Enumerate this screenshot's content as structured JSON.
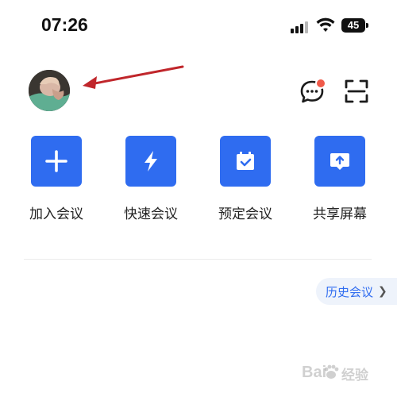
{
  "status_bar": {
    "time": "07:26",
    "battery": "45",
    "icons": [
      "signal-icon",
      "wifi-icon",
      "battery-icon"
    ]
  },
  "header": {
    "avatar": "user-avatar",
    "icons": [
      "message-icon",
      "scan-icon"
    ],
    "notification_dot_color": "#f05a4a",
    "annotation_arrow_color": "#c0262b"
  },
  "actions": [
    {
      "label": "加入会议",
      "icon": "plus-icon"
    },
    {
      "label": "快速会议",
      "icon": "lightning-icon"
    },
    {
      "label": "预定会议",
      "icon": "calendar-icon"
    },
    {
      "label": "共享屏幕",
      "icon": "share-screen-icon"
    }
  ],
  "history_button": {
    "label": "历史会议",
    "icon": "chevron-right-icon"
  },
  "watermark": {
    "text": "Bai",
    "text2": "经验"
  },
  "colors": {
    "accent": "#2f6cf0",
    "background": "#ffffff"
  }
}
